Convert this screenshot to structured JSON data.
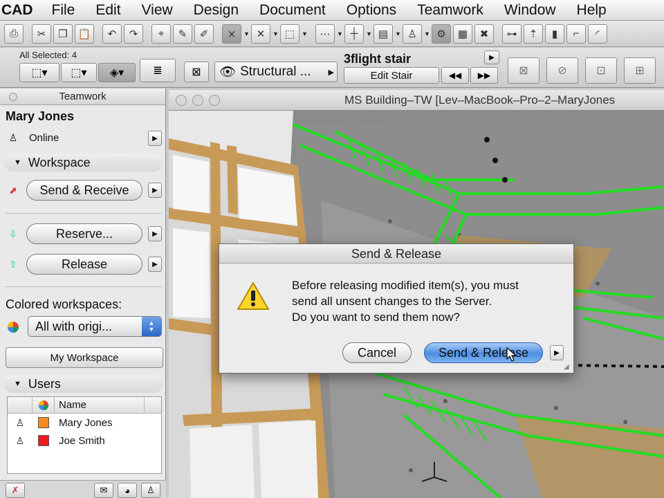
{
  "menubar": {
    "app": "CAD",
    "items": [
      "File",
      "Edit",
      "View",
      "Design",
      "Document",
      "Options",
      "Teamwork",
      "Window",
      "Help"
    ]
  },
  "toolbar": {
    "icons": [
      "print-icon",
      "cut-icon",
      "copy-icon",
      "paste-icon",
      "undo-icon",
      "redo-icon",
      "magic-wand-icon",
      "eyedropper-icon",
      "syringe-icon",
      "gravity-icon",
      "snap-guide-icon",
      "selection-icon",
      "layers-icon",
      "hatch-icon",
      "trace-icon",
      "marquee-icon",
      "figure-icon",
      "calculator-icon",
      "close-x-icon",
      "node-icon",
      "elevation-icon",
      "column-icon",
      "wall-corner-icon",
      "arc-icon"
    ],
    "all_selected": "All Selected: 4",
    "layer_combo": "Structural ...",
    "element_title": "3flight stair",
    "edit_button": "Edit Stair"
  },
  "teamwork": {
    "title": "Teamwork",
    "user": "Mary Jones",
    "status": "Online",
    "workspace_section": "Workspace",
    "send_receive": "Send & Receive",
    "reserve": "Reserve...",
    "release": "Release",
    "colored_label": "Colored workspaces:",
    "colored_value": "All with origi...",
    "my_workspace": "My Workspace",
    "users_section": "Users",
    "users_header": "Name",
    "users": [
      {
        "name": "Mary Jones",
        "color": "#f58a1f"
      },
      {
        "name": "Joe Smith",
        "color": "#ee1c1c"
      }
    ]
  },
  "document": {
    "title": "MS Building–TW  [Lev–MacBook–Pro–2–MaryJones"
  },
  "dialog": {
    "title": "Send & Release",
    "message": [
      "Before releasing modified item(s), you must",
      "send all unsent changes to the Server.",
      "Do you want to send them now?"
    ],
    "cancel": "Cancel",
    "confirm": "Send & Release"
  },
  "colors": {
    "stair_green": "#22dd22",
    "wood": "#c89a58",
    "concrete": "#8c8c8c"
  }
}
